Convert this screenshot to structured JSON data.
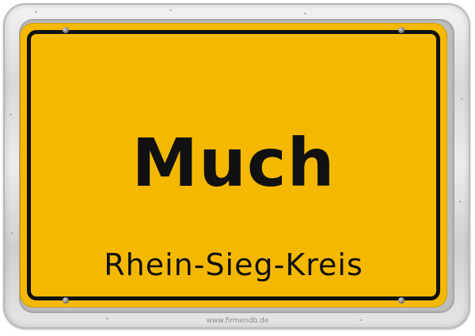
{
  "sign": {
    "town": "Much",
    "district": "Rhein-Sieg-Kreis"
  },
  "watermark": "www.firmendb.de",
  "colors": {
    "plate": "#f5b800",
    "border": "#111111",
    "frame": "#d9d9d9"
  }
}
